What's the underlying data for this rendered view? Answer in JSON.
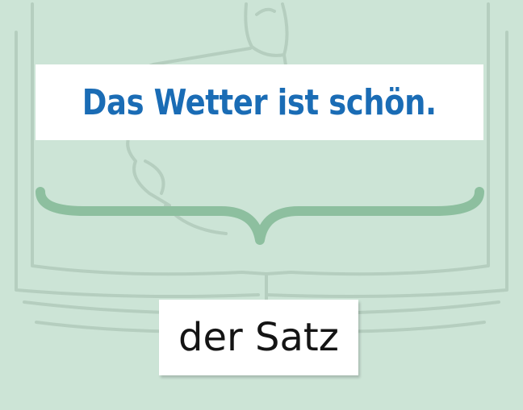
{
  "sentence": {
    "text": "Das Wetter ist schön."
  },
  "label": {
    "text": "der Satz"
  },
  "colors": {
    "background": "#cce4d6",
    "sentence_text": "#1a6cb5",
    "brace": "#8dbf9f",
    "label_text": "#141414",
    "box_fill": "#ffffff"
  },
  "icons": [
    "open-book-sketch",
    "thumbs-up-sketch",
    "curly-brace"
  ]
}
